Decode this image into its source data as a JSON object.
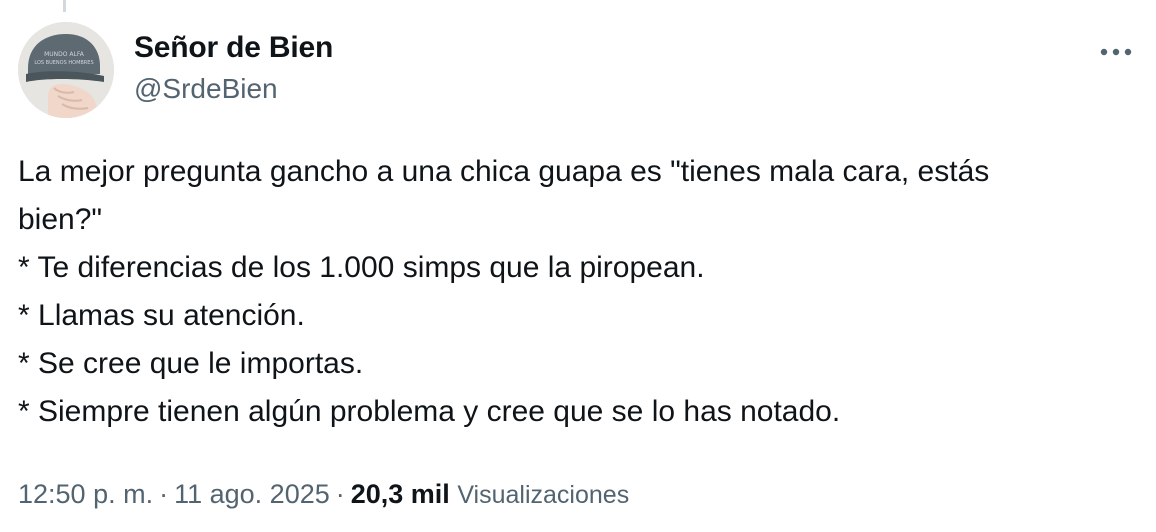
{
  "tweet": {
    "author": {
      "display_name": "Señor de Bien",
      "handle": "@SrdeBien"
    },
    "more_icon": "ellipsis-horizontal-icon",
    "text_lines": [
      "La mejor pregunta gancho a una chica guapa es \"tienes mala cara, estás",
      "bien?\"",
      "* Te diferencias de los 1.000 simps que la piropean.",
      "* Llamas su atención.",
      "* Se cree que le importas.",
      "* Siempre tienen algún problema y cree que se lo has notado."
    ],
    "meta": {
      "time": "12:50 p. m.",
      "separator": "·",
      "date": "11 ago. 2025",
      "views_count": "20,3 mil",
      "views_label": "Visualizaciones"
    }
  },
  "colors": {
    "text_primary": "#0f1419",
    "text_secondary": "#536471",
    "background": "#ffffff",
    "thread_line": "#cfd9de"
  }
}
